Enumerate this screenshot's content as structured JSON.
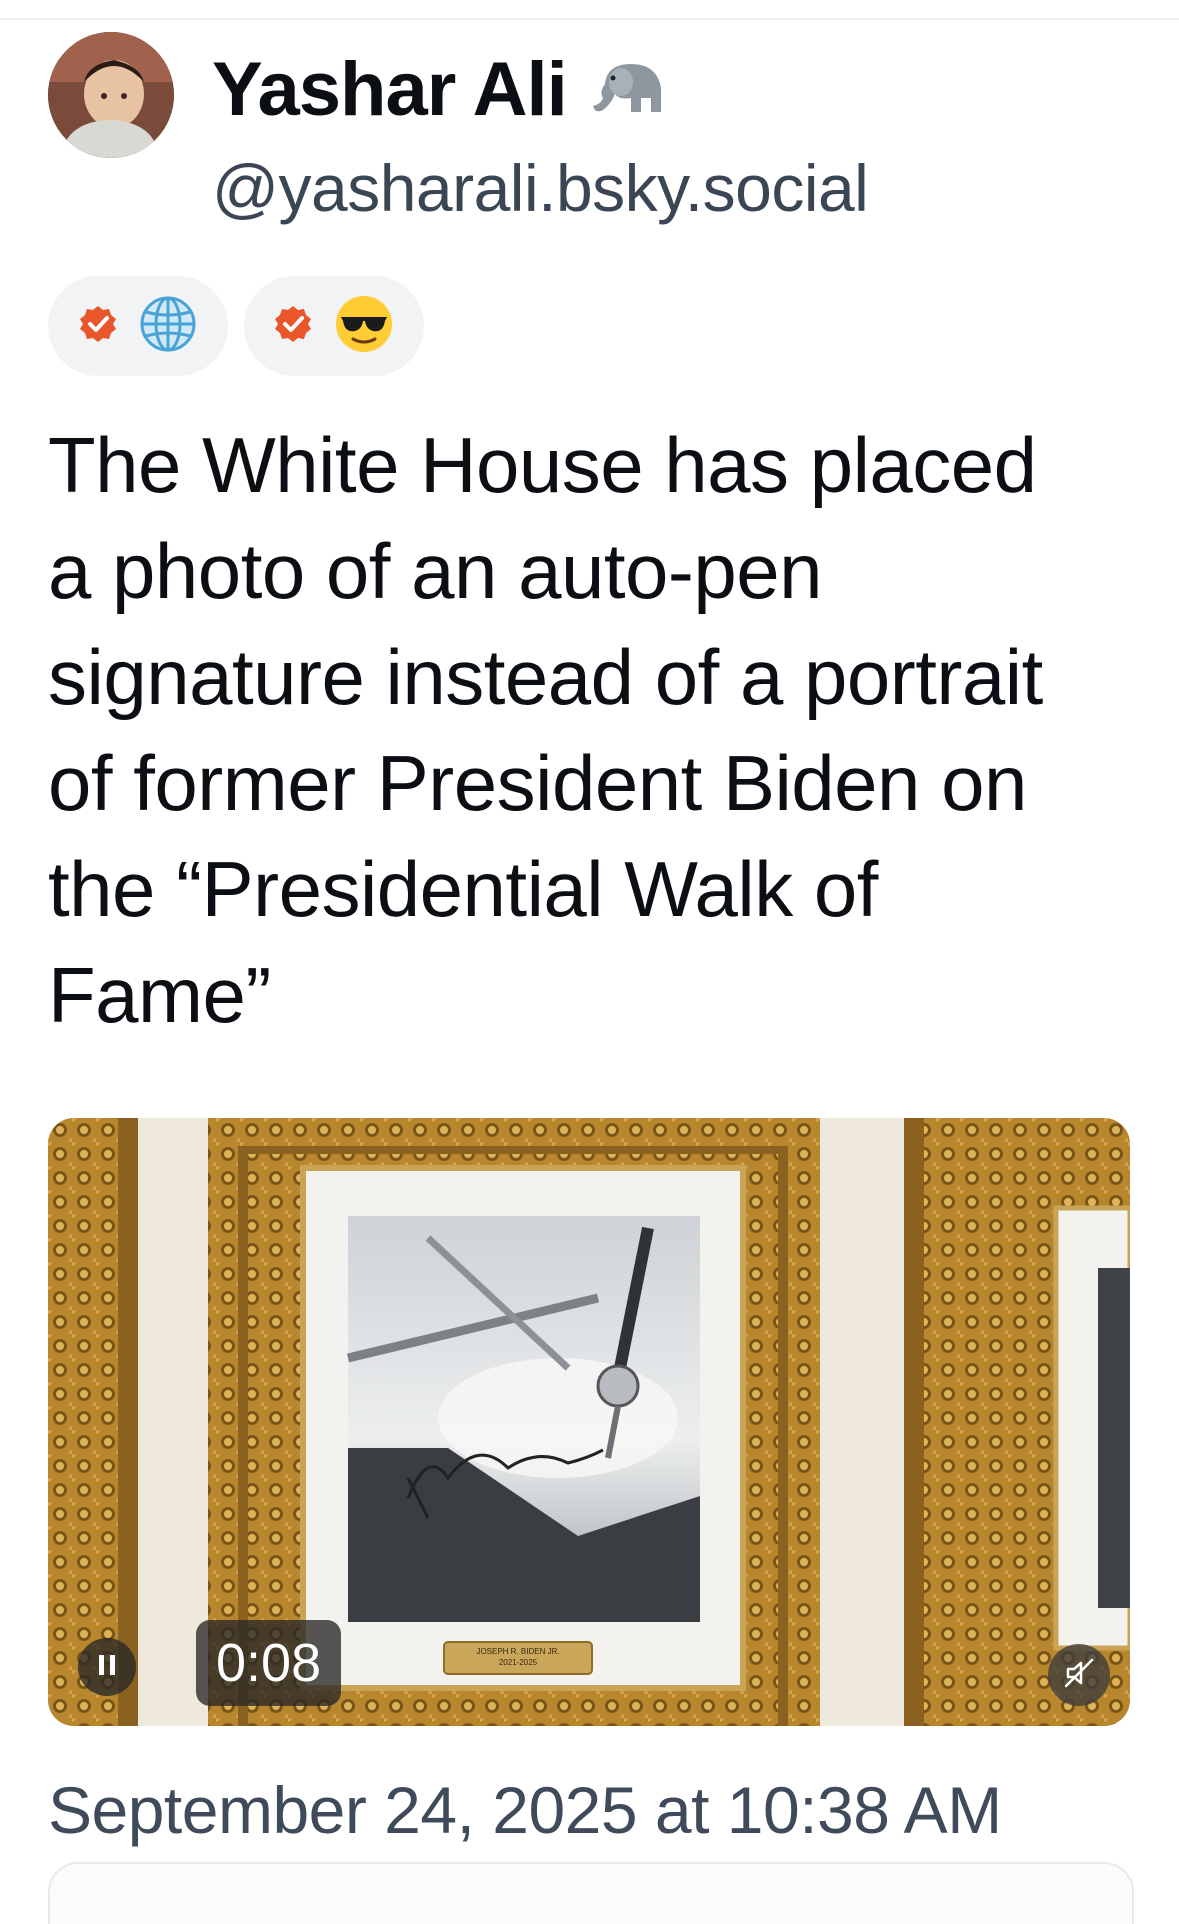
{
  "author": {
    "display_name": "Yashar Ali",
    "name_emoji": "elephant-emoji",
    "handle": "@yasharali.bsky.social"
  },
  "badges": [
    {
      "check": "verified-check-icon",
      "emoji": "globe-icon"
    },
    {
      "check": "verified-check-icon",
      "emoji": "sunglasses-face-icon"
    }
  ],
  "post": {
    "text": "The White House has placed\na photo of an auto-pen\nsignature instead of a portrait\nof former President Biden on\nthe “Presidential Walk of\nFame”"
  },
  "media": {
    "type": "video",
    "elapsed_time": "0:08",
    "plaque_text": "JOSEPH R. BIDEN JR.\n2021-2025"
  },
  "timestamp": "September 24, 2025 at 10:38 AM",
  "colors": {
    "verified_check": "#e8562a",
    "frame_gold": "#b8862c",
    "handle_text": "#3b4654"
  }
}
